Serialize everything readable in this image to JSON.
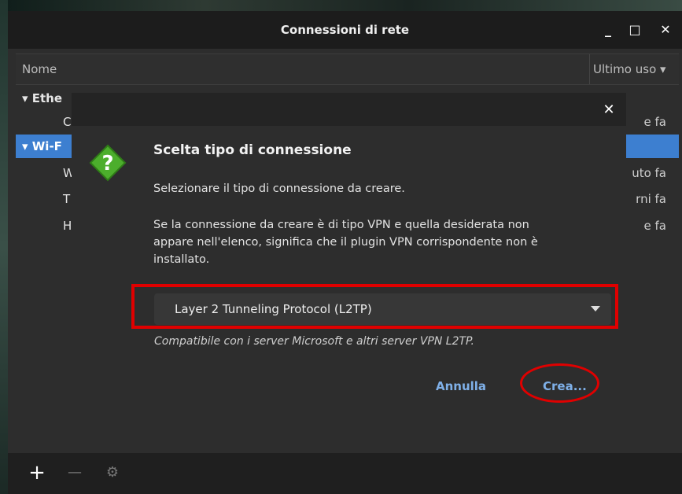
{
  "window": {
    "title": "Connessioni di rete",
    "minimize_label": "_",
    "maximize_label": "□",
    "close_label": "✕"
  },
  "list": {
    "columns": {
      "name": "Nome",
      "last_used": "Ultimo uso ▾"
    },
    "groups": [
      {
        "label": "▾ Ethe",
        "rows": [
          {
            "name": "C",
            "last_used": "e fa"
          }
        ]
      },
      {
        "label": "▾ Wi-F",
        "rows": [
          {
            "name": "W",
            "last_used": "uto fa"
          },
          {
            "name": "T",
            "last_used": "rni fa"
          },
          {
            "name": "H",
            "last_used": "e fa"
          }
        ]
      }
    ]
  },
  "bottombar": {
    "add": "+",
    "remove": "—",
    "settings": "⚙"
  },
  "dialog": {
    "close_label": "✕",
    "icon_glyph": "?",
    "title": "Scelta tipo di connessione",
    "instruction": "Selezionare il tipo di connessione da creare.",
    "vpn_note_line1": "Se la connessione da creare è di tipo VPN e quella desiderata non",
    "vpn_note_line2": "appare nell'elenco, significa che il plugin VPN corrispondente non è",
    "vpn_note_line3": "installato.",
    "connection_type": "Layer 2 Tunneling Protocol (L2TP)",
    "hint": "Compatibile con i server Microsoft e altri server VPN L2TP.",
    "cancel_label": "Annulla",
    "create_label": "Crea..."
  },
  "colors": {
    "accent": "#3d7fd0",
    "button_text": "#7fb0e8",
    "annotation": "#e00000",
    "icon_green": "#4cae2c"
  }
}
